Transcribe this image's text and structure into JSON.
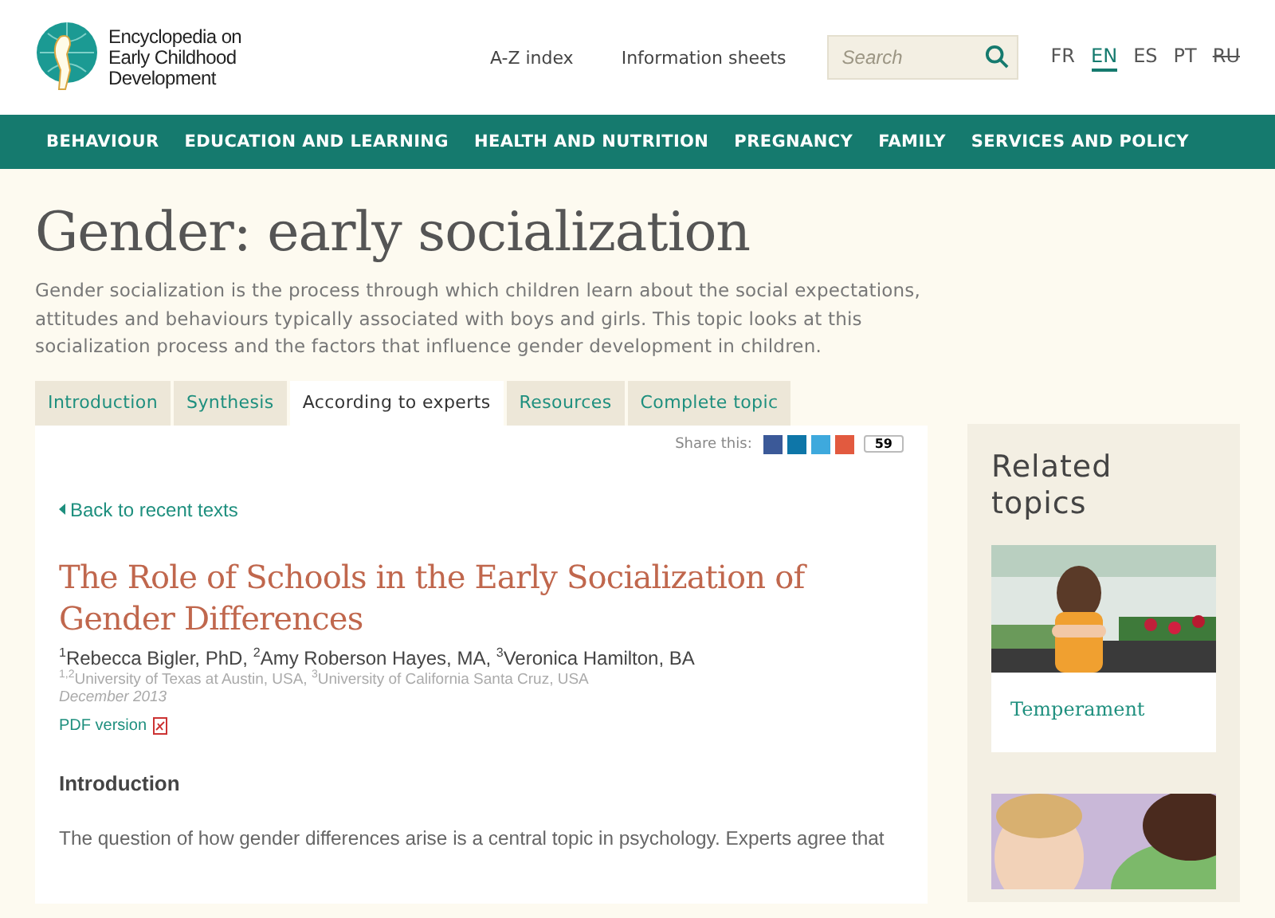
{
  "header": {
    "logo_text": "Encyclopedia on Early Childhood Development",
    "links": [
      "A-Z index",
      "Information sheets"
    ],
    "search": {
      "placeholder": "Search"
    },
    "languages": [
      {
        "label": "FR",
        "selected": false,
        "disabled": false
      },
      {
        "label": "EN",
        "selected": true,
        "disabled": false
      },
      {
        "label": "ES",
        "selected": false,
        "disabled": false
      },
      {
        "label": "PT",
        "selected": false,
        "disabled": false
      },
      {
        "label": "RU",
        "selected": false,
        "disabled": true
      }
    ]
  },
  "nav": [
    "BEHAVIOUR",
    "EDUCATION AND LEARNING",
    "HEALTH AND NUTRITION",
    "PREGNANCY",
    "FAMILY",
    "SERVICES AND POLICY"
  ],
  "page": {
    "title": "Gender: early socialization",
    "intro": "Gender socialization is the process through which children learn about the social expectations, attitudes and behaviours typically associated with boys and girls. This topic looks at this socialization process and the factors that influence gender development in children."
  },
  "tabs": [
    {
      "label": "Introduction",
      "selected": false
    },
    {
      "label": "Synthesis",
      "selected": false
    },
    {
      "label": "According to experts",
      "selected": true
    },
    {
      "label": "Resources",
      "selected": false
    },
    {
      "label": "Complete topic",
      "selected": false
    }
  ],
  "article": {
    "share_label": "Share this:",
    "share_count": "59",
    "back_link": "Back to recent texts",
    "title": "The Role of Schools in the Early Socialization of Gender Differences",
    "authors": "$^{1}$Rebecca Bigler, PhD, $^{2}$Amy Roberson Hayes, MA, $^{3}$Veronica Hamilton, BA",
    "affiliations": "$^{1,2}$University of Texas at Austin, USA, $^{3}$University of California Santa Cruz, USA",
    "date": "December 2013",
    "pdf_link": "PDF version",
    "section_heading": "Introduction",
    "paragraph": "The question of how gender differences arise is a central topic in psychology. Experts agree that"
  },
  "sidebar": {
    "title": "Related topics",
    "cards": [
      {
        "kind": "picture",
        "label": "Temperament"
      },
      {
        "kind": "picture"
      }
    ]
  }
}
